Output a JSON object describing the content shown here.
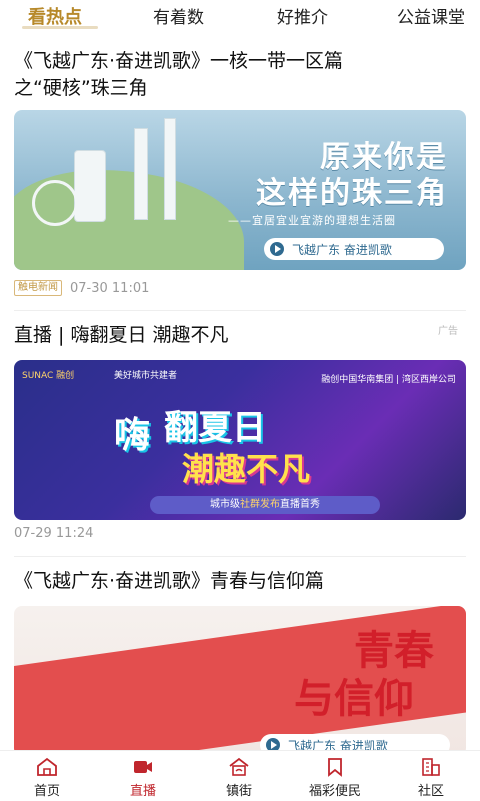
{
  "top_tabs": [
    {
      "label": "看热点"
    },
    {
      "label": "有着数"
    },
    {
      "label": "好推介"
    },
    {
      "label": "公益课堂"
    }
  ],
  "feed": [
    {
      "title": "《飞越广东·奋进凯歌》一核一带一区篇之“硬核”珠三角",
      "title_line1": "《飞越广东·奋进凯歌》一核一带一区篇",
      "title_line2": "之“硬核”珠三角",
      "thumb_heading_1": "原来你是",
      "thumb_heading_2": "这样的珠三角",
      "thumb_subtitle": "——宜居宜业宜游的理想生活圈",
      "thumb_pill": "飞越广东  奋进凯歌",
      "source": "触电新闻",
      "time": "07-30 11:01"
    },
    {
      "title": "直播 | 嗨翻夏日 潮趣不凡",
      "ad_label": "广告",
      "thumb_brand_left": "SUNAC 融创",
      "thumb_brand_mid": "美好城市共建者",
      "thumb_brand_right": "融创中国华南集团 | 湾区西岸公司",
      "thumb_word_1": "嗨",
      "thumb_word_2": "翻夏日",
      "thumb_word_3": "潮趣不凡",
      "thumb_banner_prefix": "城市级",
      "thumb_banner_highlight": "社群发布",
      "thumb_banner_suffix": "直播首秀",
      "time": "07-29 11:24"
    },
    {
      "title": "《飞越广东·奋进凯歌》青春与信仰篇",
      "thumb_title_1": "青春",
      "thumb_title_2": "与信仰",
      "thumb_pill": "飞越广东  奋进凯歌"
    }
  ],
  "bottom_nav": [
    {
      "label": "首页",
      "icon": "home-icon"
    },
    {
      "label": "直播",
      "icon": "live-camera-icon",
      "active": true
    },
    {
      "label": "镇街",
      "icon": "town-icon"
    },
    {
      "label": "福彩便民",
      "icon": "bookmark-icon"
    },
    {
      "label": "社区",
      "icon": "community-icon"
    }
  ],
  "colors": {
    "active_tab": "#b7892a",
    "active_nav": "#c0262d"
  }
}
